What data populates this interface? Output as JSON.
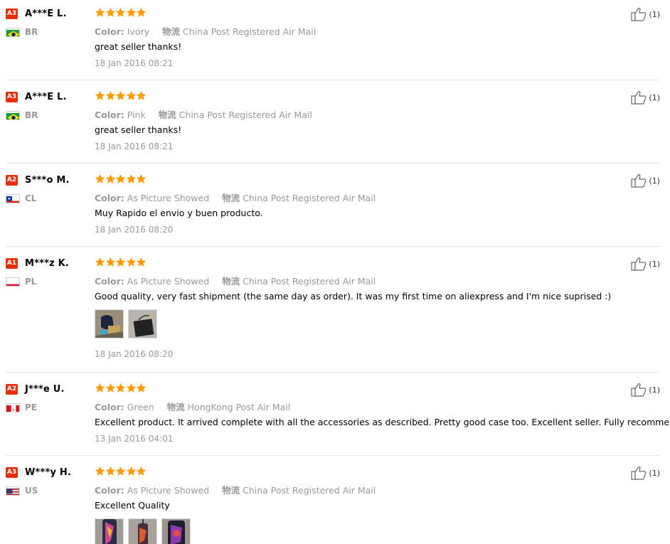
{
  "labels": {
    "color": "Color:",
    "logistics": "物流"
  },
  "accent": "#e62e04",
  "star_color": "#ff9a00",
  "reviews": [
    {
      "level": "A3",
      "name": "A***E L.",
      "country": "BR",
      "color": "Ivory",
      "shipping": "China Post Registered Air Mail",
      "text": "great seller thanks!",
      "date": "18 Jan 2016 08:21",
      "likes": "(1)",
      "rating": 5
    },
    {
      "level": "A3",
      "name": "A***E L.",
      "country": "BR",
      "color": "Pink",
      "shipping": "China Post Registered Air Mail",
      "text": "great seller thanks!",
      "date": "18 Jan 2016 08:21",
      "likes": "(1)",
      "rating": 5
    },
    {
      "level": "A2",
      "name": "S***o M.",
      "country": "CL",
      "color": "As Picture Showed",
      "shipping": "China Post Registered Air Mail",
      "text": "Muy Rapido el envio y buen producto.",
      "date": "18 Jan 2016 08:20",
      "likes": "(1)",
      "rating": 5
    },
    {
      "level": "A1",
      "name": "M***z K.",
      "country": "PL",
      "color": "As Picture Showed",
      "shipping": "China Post Registered Air Mail",
      "text": "Good quality, very fast shipment (the same day as order). It was my first time on aliexpress and I'm nice suprised :)",
      "date": "18 Jan 2016 08:20",
      "likes": "(1)",
      "rating": 5
    },
    {
      "level": "A2",
      "name": "J***e U.",
      "country": "PE",
      "color": "Green",
      "shipping": "HongKong Post Air Mail",
      "text": "Excellent product. It arrived complete with all the accessories as described. Pretty good case too. Excellent seller. Fully recommended.",
      "date": "13 Jan 2016 04:01",
      "likes": "(1)",
      "rating": 5
    },
    {
      "level": "A3",
      "name": "W***y H.",
      "country": "US",
      "color": "As Picture Showed",
      "shipping": "China Post Registered Air Mail",
      "text": "Excellent Quality",
      "date": "",
      "likes": "(1)",
      "rating": 5
    }
  ]
}
